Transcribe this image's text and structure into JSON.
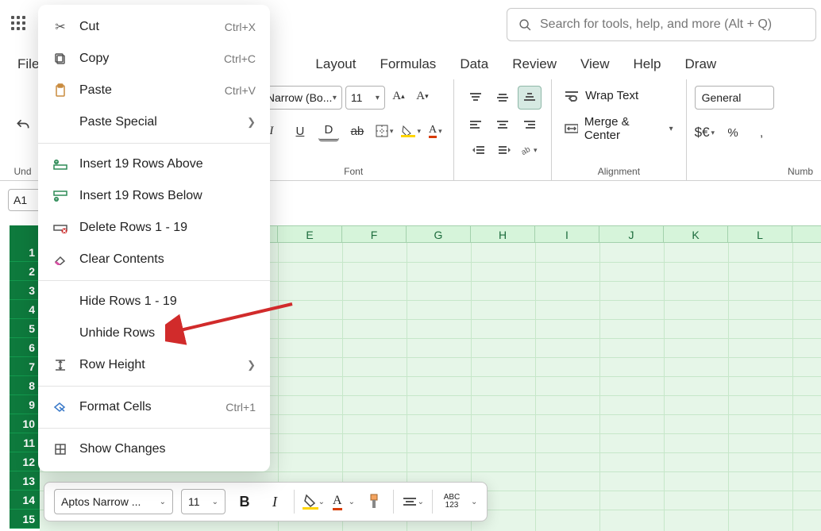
{
  "search": {
    "placeholder": "Search for tools, help, and more (Alt + Q)"
  },
  "menuTabs": {
    "file": "File",
    "layout": "Layout",
    "formulas": "Formulas",
    "data": "Data",
    "review": "Review",
    "view": "View",
    "help": "Help",
    "draw": "Draw"
  },
  "ribbon": {
    "undo_label": "Und",
    "font": {
      "name": "Narrow (Bo...",
      "size": "11",
      "group_label": "Font"
    },
    "alignment": {
      "wrap_text": "Wrap Text",
      "merge_center": "Merge & Center",
      "group_label": "Alignment"
    },
    "number": {
      "format": "General",
      "currency": "$€",
      "percent": "%",
      "comma": ",",
      "group_label": "Numb"
    }
  },
  "nameBox": "A1",
  "columns": [
    "E",
    "F",
    "G",
    "H",
    "I",
    "J",
    "K",
    "L"
  ],
  "rows": [
    "1",
    "2",
    "3",
    "4",
    "5",
    "6",
    "7",
    "8",
    "9",
    "10",
    "11",
    "12",
    "13",
    "14",
    "15"
  ],
  "miniToolbar": {
    "font": "Aptos Narrow ...",
    "size": "11",
    "abc": "ABC",
    "abc_sub": "123"
  },
  "contextMenu": {
    "cut": {
      "label": "Cut",
      "shortcut": "Ctrl+X"
    },
    "copy": {
      "label": "Copy",
      "shortcut": "Ctrl+C"
    },
    "paste": {
      "label": "Paste",
      "shortcut": "Ctrl+V"
    },
    "paste_special": {
      "label": "Paste Special"
    },
    "insert_above": {
      "label": "Insert 19 Rows Above"
    },
    "insert_below": {
      "label": "Insert 19 Rows Below"
    },
    "delete_rows": {
      "label": "Delete Rows 1 - 19"
    },
    "clear": {
      "label": "Clear Contents"
    },
    "hide": {
      "label": "Hide Rows 1 - 19"
    },
    "unhide": {
      "label": "Unhide Rows"
    },
    "row_height": {
      "label": "Row Height"
    },
    "format_cells": {
      "label": "Format Cells",
      "shortcut": "Ctrl+1"
    },
    "show_changes": {
      "label": "Show Changes"
    }
  }
}
